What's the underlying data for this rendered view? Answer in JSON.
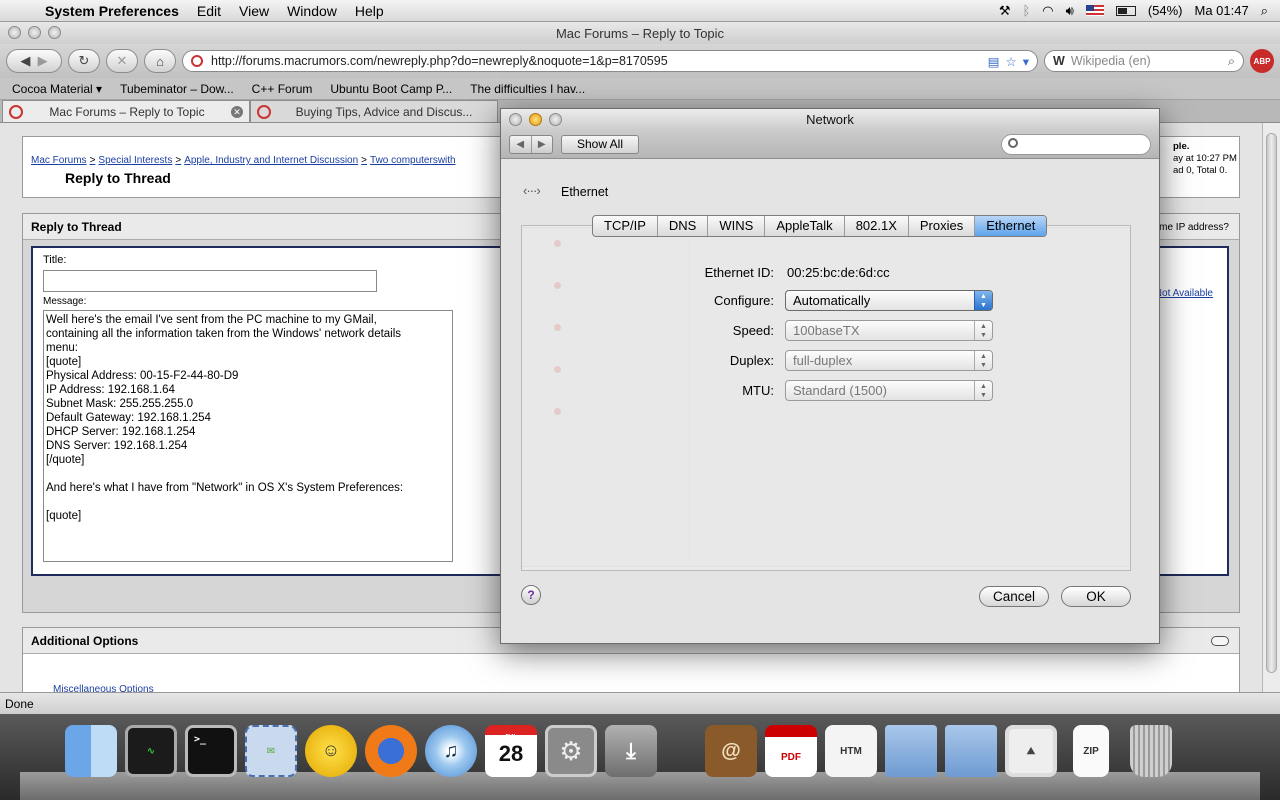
{
  "menubar": {
    "app_name": "System Preferences",
    "menus": [
      "Edit",
      "View",
      "Window",
      "Help"
    ],
    "battery": "(54%)",
    "clock": "Ma 01:47"
  },
  "browser": {
    "window_title": "Mac Forums – Reply to Topic",
    "url": "http://forums.macrumors.com/newreply.php?do=newreply&noquote=1&p=8170595",
    "search_placeholder": "Wikipedia (en)",
    "abp_label": "ABP",
    "bookmarks": [
      "Cocoa Material ▾",
      "Tubeminator – Dow...",
      "C++ Forum",
      "Ubuntu Boot Camp P...",
      "The difficulties I hav..."
    ],
    "tabs": [
      {
        "label": "Mac Forums – Reply to Topic",
        "active": true
      },
      {
        "label": "Buying Tips, Advice and Discus...",
        "active": false
      }
    ],
    "status": "Done"
  },
  "forum": {
    "breadcrumbs": [
      "Mac Forums",
      "Special Interests",
      "Apple, Industry and Internet Discussion",
      "Two computerswith"
    ],
    "page_title": "Reply to Thread",
    "right_snippet": [
      "ple.",
      "ay at 10:27 PM",
      "ad 0, Total 0."
    ],
    "reply_header": "Reply to Thread",
    "title_label": "Title:",
    "title_value": "",
    "message_label": "Message:",
    "message_text": "Well here's the email I've sent from the PC machine to my GMail,\ncontaining all the information taken from the Windows' network details\nmenu:\n[quote]\nPhysical Address: 00-15-F2-44-80-D9\nIP Address: 192.168.1.64\nSubnet Mask: 255.255.255.0\nDefault Gateway: 192.168.1.254\nDHCP Server: 192.168.1.254\nDNS Server: 192.168.1.254\n[/quote]\n\nAnd here's what I have from \"Network\" in OS X's System Preferences:\n\n[quote]",
    "same_ip_text": "me IP address?",
    "not_available": "Not Available",
    "additional_options": "Additional Options",
    "misc_options": "Miscellaneous Options"
  },
  "network": {
    "window_title": "Network",
    "show_all": "Show All",
    "interface": "Ethernet",
    "tabs": [
      "TCP/IP",
      "DNS",
      "WINS",
      "AppleTalk",
      "802.1X",
      "Proxies",
      "Ethernet"
    ],
    "selected_tab": "Ethernet",
    "ethernet_id_label": "Ethernet ID:",
    "ethernet_id": "00:25:bc:de:6d:cc",
    "configure_label": "Configure:",
    "configure_value": "Automatically",
    "speed_label": "Speed:",
    "speed_value": "100baseTX",
    "duplex_label": "Duplex:",
    "duplex_value": "full-duplex",
    "mtu_label": "MTU:",
    "mtu_value": "Standard  (1500)",
    "cancel": "Cancel",
    "ok": "OK",
    "help": "?"
  },
  "dock": {
    "items": [
      "Finder",
      "Activity Monitor",
      "Terminal",
      "Mail",
      "Adium",
      "Firefox",
      "iTunes",
      "iCal",
      "System Preferences",
      "Instruments",
      "Address Book",
      "PDF",
      "HTM",
      "Folder",
      "Folder",
      "Preview",
      "ZIP",
      "Trash"
    ],
    "ical_month": "JUL",
    "ical_day": "28",
    "pdf_label": "PDF",
    "htm_label": "HTM",
    "zip_label": "ZIP"
  }
}
